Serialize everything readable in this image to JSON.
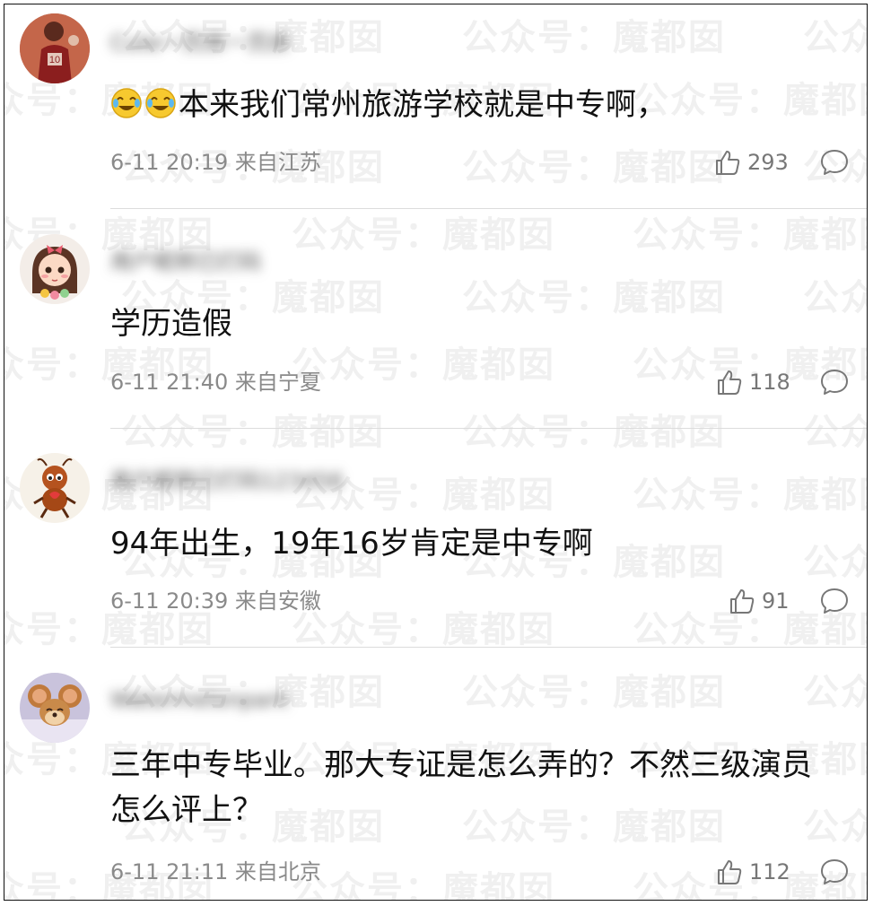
{
  "watermark_text": "公众号：魔都囡",
  "comments": [
    {
      "username": "Cute一页床一页床",
      "avatar": "basketball-player-avatar",
      "emoji": [
        "cry-laugh-emoji",
        "cry-laugh-emoji"
      ],
      "text": "本来我们常州旅游学校就是中专啊，",
      "time": "6-11 20:19",
      "location": "来自江苏",
      "likes": "293"
    },
    {
      "username": "用户昵称已打码",
      "avatar": "cartoon-girl-avatar",
      "emoji": [],
      "text": "学历造假",
      "time": "6-11 21:40",
      "location": "来自宁夏",
      "likes": "118"
    },
    {
      "username": "用户昵称已打码123456",
      "avatar": "ant-avatar",
      "emoji": [],
      "text": "94年出生，19年16岁肯定是中专啊",
      "time": "6-11 20:39",
      "location": "来自安徽",
      "likes": "91"
    },
    {
      "username": "Watermelonpark",
      "avatar": "jerry-mouse-avatar",
      "emoji": [],
      "text": "三年中专毕业。那大专证是怎么弄的？不然三级演员怎么评上？",
      "time": "6-11 21:11",
      "location": "来自北京",
      "likes": "112"
    }
  ]
}
